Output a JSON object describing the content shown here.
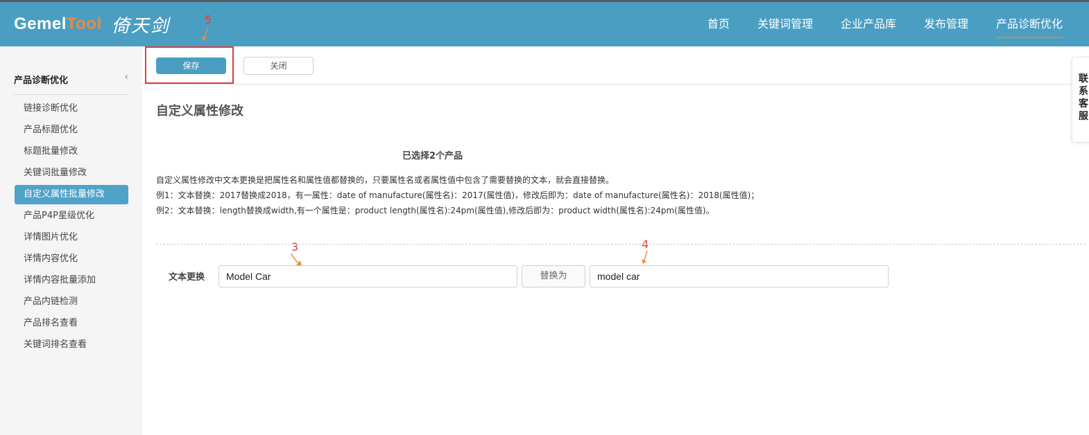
{
  "header": {
    "logo_part1": "Gemel",
    "logo_part2": "Tool",
    "logo_chinese": "倚天剑",
    "nav": [
      {
        "label": "首页"
      },
      {
        "label": "关键词管理"
      },
      {
        "label": "企业产品库"
      },
      {
        "label": "发布管理"
      },
      {
        "label": "产品诊断优化"
      }
    ],
    "active_nav": "产品诊断优化"
  },
  "sidebar": {
    "title": "产品诊断优化",
    "chevron_icon": "chevron-left-icon",
    "items": [
      {
        "label": "链接诊断优化"
      },
      {
        "label": "产品标题优化"
      },
      {
        "label": "标题批量修改"
      },
      {
        "label": "关键词批量修改"
      },
      {
        "label": "自定义属性批量修改"
      },
      {
        "label": "产品P4P星级优化"
      },
      {
        "label": "详情图片优化"
      },
      {
        "label": "详情内容优化"
      },
      {
        "label": "详情内容批量添加"
      },
      {
        "label": "产品内链检测"
      },
      {
        "label": "产品排名查看"
      },
      {
        "label": "关键词排名查看"
      }
    ],
    "active_item": "自定义属性批量修改"
  },
  "toolbar": {
    "save_label": "保存",
    "close_label": "关闭"
  },
  "annotations": {
    "save_marker": "5",
    "from_marker": "3",
    "to_marker": "4"
  },
  "main": {
    "title": "自定义属性修改",
    "selected_count": "已选择2个产品",
    "desc_line1": "自定义属性修改中文本更换是把属性名和属性值都替换的，只要属性名或者属性值中包含了需要替换的文本，就会直接替换。",
    "desc_line2": "例1：文本替换：2017替换成2018，有一属性：date of manufacture(属性名)：2017(属性值)，修改后即为：date of manufacture(属性名)：2018(属性值)；",
    "desc_line3": "例2：文本替换：length替换成width,有一个属性是：product length(属性名):24pm(属性值),修改后即为：product width(属性名):24pm(属性值)。",
    "row_label": "文本更换",
    "from_value": "Model Car",
    "replace_label": "替换为",
    "to_value": "model car"
  },
  "float": {
    "chars": [
      "联",
      "系",
      "客",
      "服"
    ]
  },
  "colors": {
    "header_bg": "#4a9ec2",
    "logo_accent": "#f0883a",
    "highlight_red": "#e03a3a",
    "active_item_bg": "#4fa3c8",
    "arrow_orange": "#ef8a3a"
  }
}
